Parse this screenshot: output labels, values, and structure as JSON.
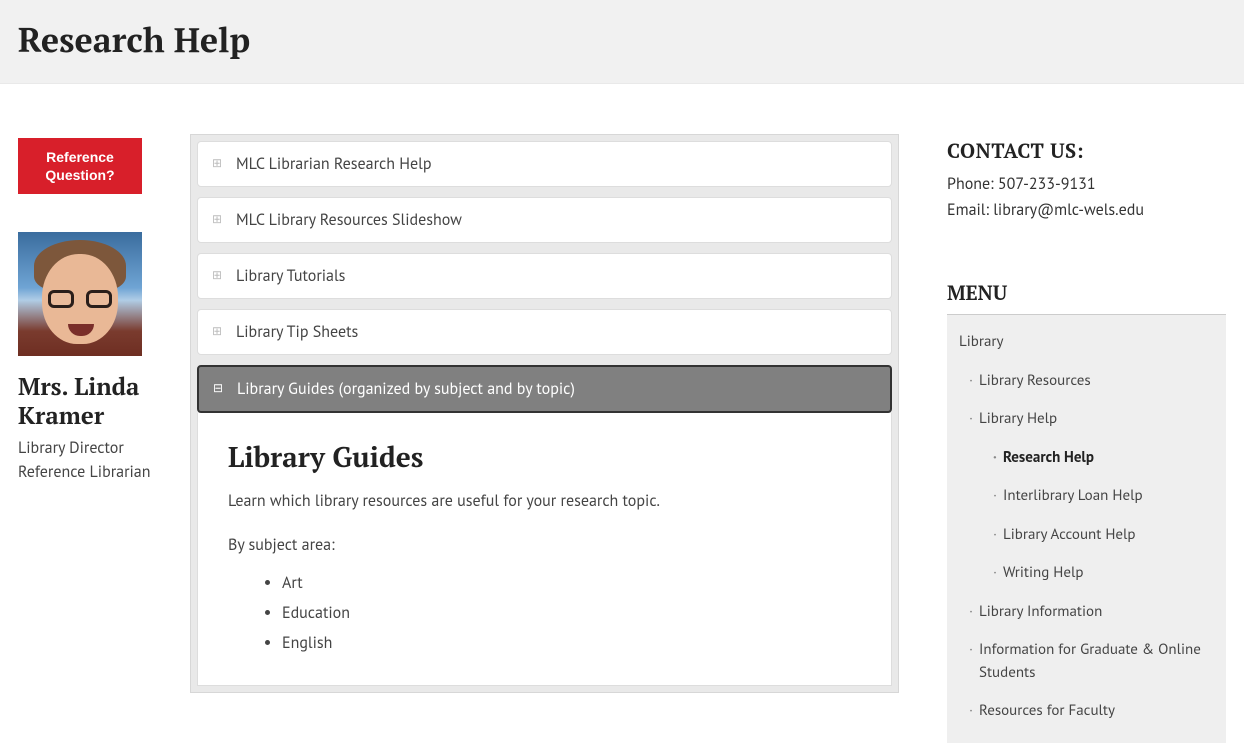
{
  "page": {
    "title": "Research Help"
  },
  "left": {
    "ref_btn_line1": "Reference",
    "ref_btn_line2": "Question?",
    "person_name": "Mrs. Linda Kramer",
    "person_title1": "Library Director",
    "person_title2": "Reference Librarian"
  },
  "accordion": {
    "items": [
      {
        "label": "MLC Librarian Research Help",
        "open": false
      },
      {
        "label": "MLC Library Resources Slideshow",
        "open": false
      },
      {
        "label": "Library Tutorials",
        "open": false
      },
      {
        "label": "Library Tip Sheets",
        "open": false
      },
      {
        "label": "Library Guides (organized by subject and by topic)",
        "open": true
      }
    ],
    "panel": {
      "heading": "Library Guides",
      "intro": "Learn which library resources are useful for your research topic.",
      "by_subject_label": "By subject area:",
      "subjects": [
        "Art",
        "Education",
        "English"
      ]
    }
  },
  "contact": {
    "heading": "CONTACT US:",
    "phone": "Phone: 507-233-9131",
    "email": "Email: library@mlc-wels.edu"
  },
  "menu": {
    "heading": "MENU",
    "root": "Library",
    "l1": [
      {
        "label": "Library Resources",
        "children": []
      },
      {
        "label": "Library Help",
        "children": [
          {
            "label": "Research Help",
            "current": true
          },
          {
            "label": "Interlibrary Loan Help"
          },
          {
            "label": "Library Account Help"
          },
          {
            "label": "Writing Help"
          }
        ]
      },
      {
        "label": "Library Information",
        "children": []
      },
      {
        "label": "Information for Graduate & Online Students",
        "children": []
      },
      {
        "label": "Resources for Faculty",
        "children": []
      }
    ]
  }
}
